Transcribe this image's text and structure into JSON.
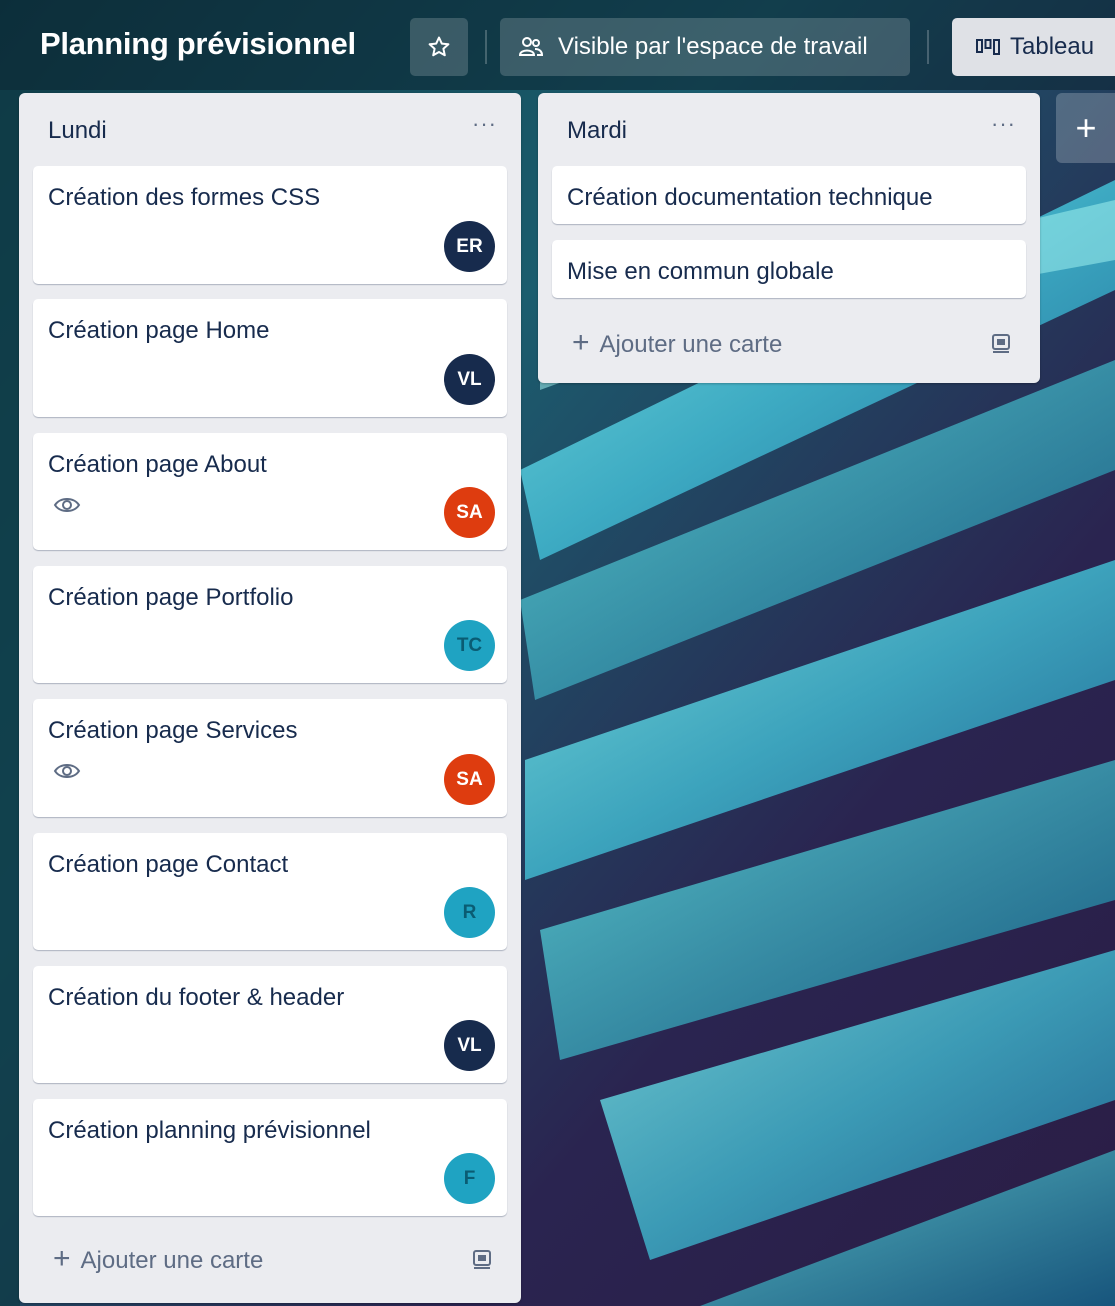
{
  "board": {
    "title": "Planning prévisionnel",
    "visibility_label": "Visible par l'espace de travail",
    "view_label": "Tableau"
  },
  "lists": [
    {
      "title": "Lundi",
      "menu": "···",
      "cards": [
        {
          "title": "Création des formes CSS",
          "avatar": "ER",
          "watching": false
        },
        {
          "title": "Création page Home",
          "avatar": "VL",
          "watching": false
        },
        {
          "title": "Création page About",
          "avatar": "SA",
          "watching": true
        },
        {
          "title": "Création page Portfolio",
          "avatar": "TC",
          "watching": false
        },
        {
          "title": "Création page Services",
          "avatar": "SA",
          "watching": true
        },
        {
          "title": "Création page Contact",
          "avatar": "R",
          "watching": false
        },
        {
          "title": "Création du footer & header",
          "avatar": "VL",
          "watching": false
        },
        {
          "title": "Création planning prévisionnel",
          "avatar": "F",
          "watching": false
        }
      ],
      "add_card_label": "Ajouter une carte"
    },
    {
      "title": "Mardi",
      "menu": "···",
      "cards": [
        {
          "title": "Création documentation technique"
        },
        {
          "title": "Mise en commun globale"
        }
      ],
      "add_card_label": "Ajouter une carte"
    }
  ],
  "add_list_label": "+",
  "colors": {
    "avatar_navy": "#172b4d",
    "avatar_orange": "#de3c0f",
    "avatar_teal": "#1fa3c2",
    "list_bg": "#ebecf0",
    "card_text": "#172b4d"
  }
}
